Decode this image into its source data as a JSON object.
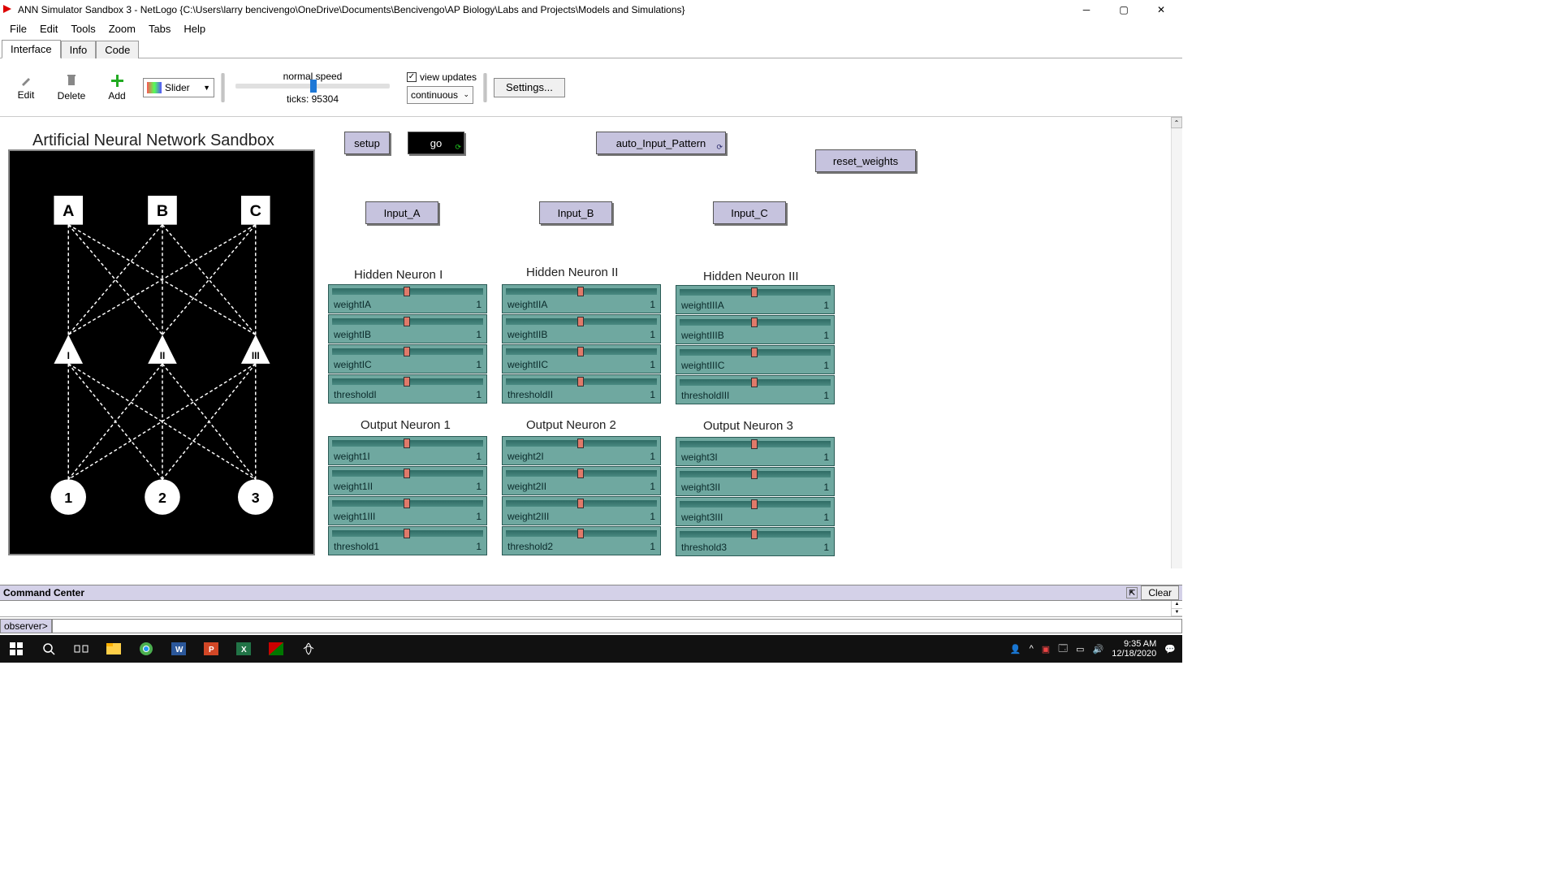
{
  "window": {
    "title": "ANN Simulator Sandbox 3 - NetLogo {C:\\Users\\larry bencivengo\\OneDrive\\Documents\\Bencivengo\\AP Biology\\Labs and Projects\\Models and Simulations}"
  },
  "menu": {
    "file": "File",
    "edit": "Edit",
    "tools": "Tools",
    "zoom": "Zoom",
    "tabs": "Tabs",
    "help": "Help"
  },
  "tabs": {
    "interface": "Interface",
    "info": "Info",
    "code": "Code"
  },
  "toolbar": {
    "edit": "Edit",
    "delete": "Delete",
    "add": "Add",
    "typebox": "Slider",
    "speed_label": "normal speed",
    "ticks": "ticks: 95304",
    "view_updates": "view updates",
    "continuous": "continuous",
    "settings": "Settings..."
  },
  "model": {
    "title": "Artificial Neural Network Sandbox",
    "inputs": [
      "A",
      "B",
      "C"
    ],
    "hidden": [
      "I",
      "II",
      "III"
    ],
    "outputs": [
      "1",
      "2",
      "3"
    ]
  },
  "buttons": {
    "setup": "setup",
    "go": "go",
    "auto": "auto_Input_Pattern",
    "reset": "reset_weights",
    "inA": "Input_A",
    "inB": "Input_B",
    "inC": "Input_C"
  },
  "headers": {
    "h1": "Hidden Neuron I",
    "h2": "Hidden Neuron II",
    "h3": "Hidden Neuron III",
    "o1": "Output Neuron 1",
    "o2": "Output Neuron 2",
    "o3": "Output Neuron 3"
  },
  "sliders": {
    "h1": [
      {
        "l": "weightIA",
        "v": "1"
      },
      {
        "l": "weightIB",
        "v": "1"
      },
      {
        "l": "weightIC",
        "v": "1"
      },
      {
        "l": "thresholdI",
        "v": "1"
      }
    ],
    "h2": [
      {
        "l": "weightIIA",
        "v": "1"
      },
      {
        "l": "weightIIB",
        "v": "1"
      },
      {
        "l": "weightIIC",
        "v": "1"
      },
      {
        "l": "thresholdII",
        "v": "1"
      }
    ],
    "h3": [
      {
        "l": "weightIIIA",
        "v": "1"
      },
      {
        "l": "weightIIIB",
        "v": "1"
      },
      {
        "l": "weightIIIC",
        "v": "1"
      },
      {
        "l": "thresholdIII",
        "v": "1"
      }
    ],
    "o1": [
      {
        "l": "weight1I",
        "v": "1"
      },
      {
        "l": "weight1II",
        "v": "1"
      },
      {
        "l": "weight1III",
        "v": "1"
      },
      {
        "l": "threshold1",
        "v": "1"
      }
    ],
    "o2": [
      {
        "l": "weight2I",
        "v": "1"
      },
      {
        "l": "weight2II",
        "v": "1"
      },
      {
        "l": "weight2III",
        "v": "1"
      },
      {
        "l": "threshold2",
        "v": "1"
      }
    ],
    "o3": [
      {
        "l": "weight3I",
        "v": "1"
      },
      {
        "l": "weight3II",
        "v": "1"
      },
      {
        "l": "weight3III",
        "v": "1"
      },
      {
        "l": "threshold3",
        "v": "1"
      }
    ]
  },
  "command": {
    "header": "Command Center",
    "clear": "Clear",
    "prompt": "observer>"
  },
  "tray": {
    "time": "9:35 AM",
    "date": "12/18/2020"
  }
}
